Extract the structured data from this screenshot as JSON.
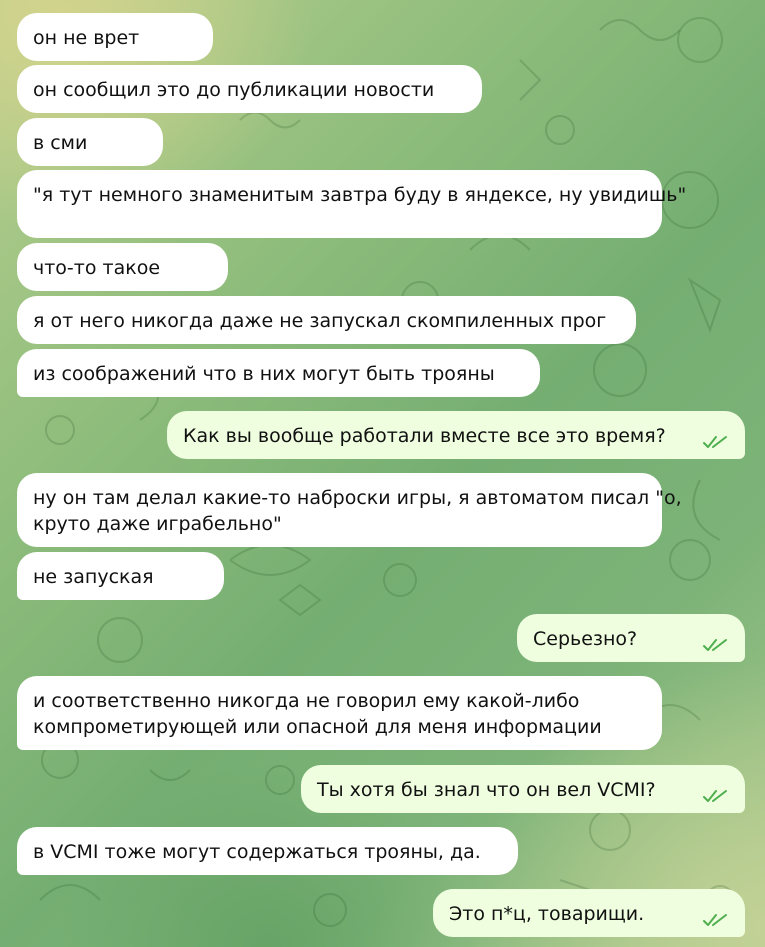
{
  "colors": {
    "incoming_bubble": "#ffffff",
    "outgoing_bubble": "#eefedf",
    "read_check": "#4fae4e",
    "text": "#111111"
  },
  "messages": [
    {
      "direction": "in",
      "text": "он не врет"
    },
    {
      "direction": "in",
      "text": "он сообщил это до публикации новости"
    },
    {
      "direction": "in",
      "text": "в сми"
    },
    {
      "direction": "in",
      "text": "\"я тут немного знаменитым завтра буду в яндексе, ну увидишь\""
    },
    {
      "direction": "in",
      "text": "что-то такое"
    },
    {
      "direction": "in",
      "text": "я от него никогда даже не запускал скомпиленных прог"
    },
    {
      "direction": "in",
      "text": "из соображений что в них могут быть трояны"
    },
    {
      "direction": "out",
      "text": "Как вы вообще работали вместе все это время?",
      "status": "read-double-check"
    },
    {
      "direction": "in",
      "lines": [
        "ну он там делал какие-то наброски игры, я автоматом писал \"о,",
        "круто даже играбельно\""
      ]
    },
    {
      "direction": "in",
      "text": "не запуская"
    },
    {
      "direction": "out",
      "text": "Серьезно?",
      "status": "read-double-check"
    },
    {
      "direction": "in",
      "lines": [
        "и соответственно никогда не говорил ему какой-либо",
        "компрометирующей или опасной для меня информации"
      ]
    },
    {
      "direction": "out",
      "text": "Ты хотя бы знал что он вел VCMI?",
      "status": "read-double-check"
    },
    {
      "direction": "in",
      "text": "в VCMI тоже могут содержаться трояны, да."
    },
    {
      "direction": "out",
      "text": "Это п*ц, товарищи.",
      "status": "read-double-check"
    }
  ]
}
